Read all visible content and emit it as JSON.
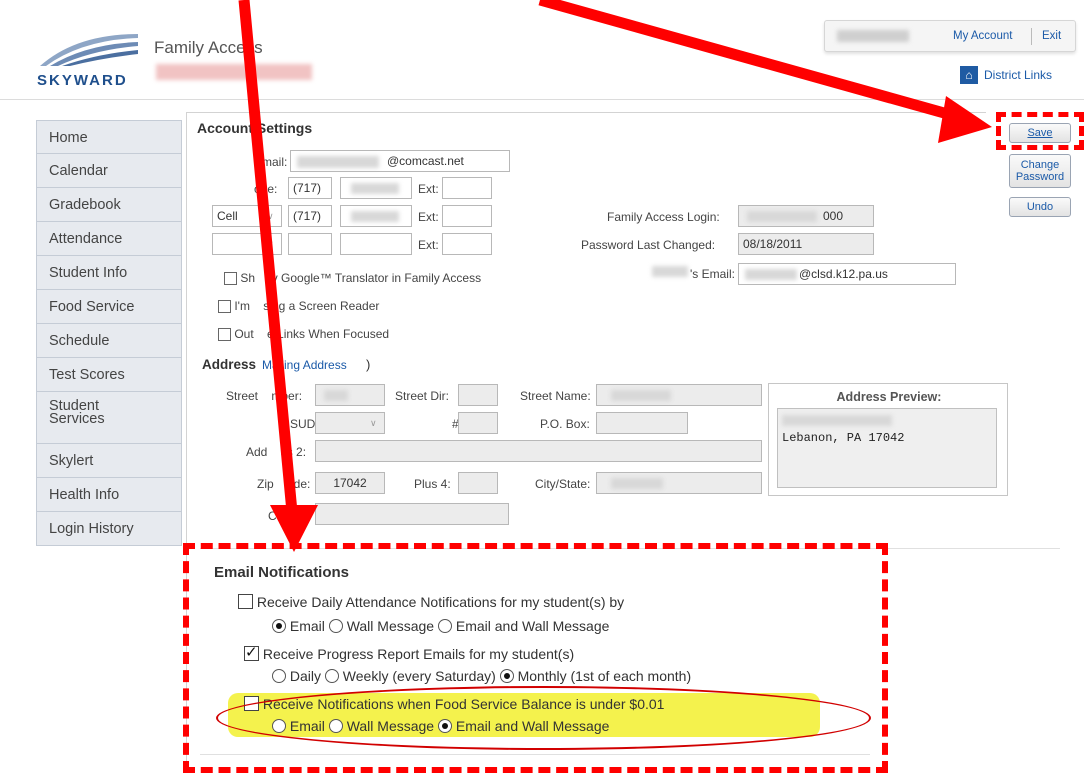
{
  "header": {
    "logo_text": "SKYWARD",
    "app_title": "Family Access",
    "my_account": "My Account",
    "exit": "Exit",
    "district_links": "District Links"
  },
  "sidebar": {
    "items": [
      {
        "label": "Home"
      },
      {
        "label": "Calendar"
      },
      {
        "label": "Gradebook"
      },
      {
        "label": "Attendance"
      },
      {
        "label": "Student Info"
      },
      {
        "label": "Food Service"
      },
      {
        "label": "Schedule"
      },
      {
        "label": "Test Scores"
      },
      {
        "label": "Student\nServices"
      },
      {
        "label": "Skylert"
      },
      {
        "label": "Health Info"
      },
      {
        "label": "Login History"
      }
    ]
  },
  "account": {
    "title": "Account Settings",
    "email_label": "Email:",
    "email_suffix": "@comcast.net",
    "phone_label": "one:",
    "area_code": "(717)",
    "ext_label": "Ext:",
    "phone2_type": "Cell",
    "family_login_label": "Family Access Login:",
    "family_login_suffix": "000",
    "pwd_changed_label": "Password Last Changed:",
    "pwd_changed_value": "08/18/2011",
    "student_email_label": "'s Email:",
    "student_email_suffix": "@clsd.k12.pa.us",
    "opt_translator": "Sh     v Google™ Translator in Family Access",
    "opt_screen_reader": "I'm    sing a Screen Reader",
    "opt_outline": "Out    e Links When Focused"
  },
  "buttons": {
    "save": "Save",
    "change_password": "Change\nPassword",
    "undo": "Undo"
  },
  "address": {
    "title": "Address",
    "mailing": "Mailing Address",
    "close_paren": ")",
    "street_number_label": "Street    mber:",
    "street_dir_label": "Street Dir:",
    "street_name_label": "Street Name:",
    "sud_label": "SUD:",
    "num_label": "#:",
    "po_box_label": "P.O. Box:",
    "address2_label": "Add    ss 2:",
    "zip_label": "Zip    ode:",
    "zip_value": "17042",
    "plus4_label": "Plus 4:",
    "city_state_label": "City/State:",
    "county_label": "C      ty:",
    "preview_title": "Address Preview:",
    "preview_line2": "Lebanon, PA 17042"
  },
  "notifications": {
    "title": "Email Notifications",
    "attendance_label": "Receive Daily Attendance Notifications for my student(s) by",
    "attendance_options": [
      "Email",
      "Wall Message",
      "Email and Wall Message"
    ],
    "progress_label": "Receive Progress Report Emails for my student(s)",
    "progress_options": [
      "Daily",
      "Weekly (every Saturday)",
      "Monthly (1st of each month)"
    ],
    "food_label": "Receive Notifications when Food Service Balance is under $0.01",
    "food_options": [
      "Email",
      "Wall Message",
      "Email and Wall Message"
    ]
  }
}
